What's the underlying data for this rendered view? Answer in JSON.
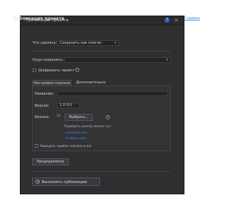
{
  "window": {
    "title": "Публикация проекта",
    "help_icon": "question-icon",
    "close_icon": "close-icon"
  },
  "header": {
    "heading": "Публикация проекта",
    "help_link": "Справка"
  },
  "action": {
    "label": "Что сделать:",
    "value": "Сохранить как плагин"
  },
  "save_to": {
    "label": "Куда сохранить:",
    "value": ""
  },
  "encrypt": {
    "label": "Шифровать проект",
    "checked": false
  },
  "tabs": [
    {
      "label": "Настройки плагина",
      "active": true
    },
    {
      "label": "Дополнительно",
      "active": false
    }
  ],
  "plugin": {
    "name_label": "Название:",
    "name_value": "",
    "version_label": "Версия:",
    "version_value": "1.0.0.0",
    "icon_label": "Иконка:",
    "icon_name": "refresh-icon",
    "choose_button": "Выбрать...",
    "hint": "Подобрать иконку можно тут:",
    "links": [
      "IconFinder.com",
      "FindIcons.com"
    ],
    "log_errors_label": "Выводить ошибки плагина в лог",
    "log_errors_checked": false
  },
  "buttons": {
    "preview": "Предпросмотр",
    "run": "Выполнить публикацию"
  },
  "colors": {
    "accent": "#4a86f0",
    "window_bg": "#2f2f31",
    "help_blue": "#2f5fd0",
    "refresh_green": "#42c060"
  }
}
